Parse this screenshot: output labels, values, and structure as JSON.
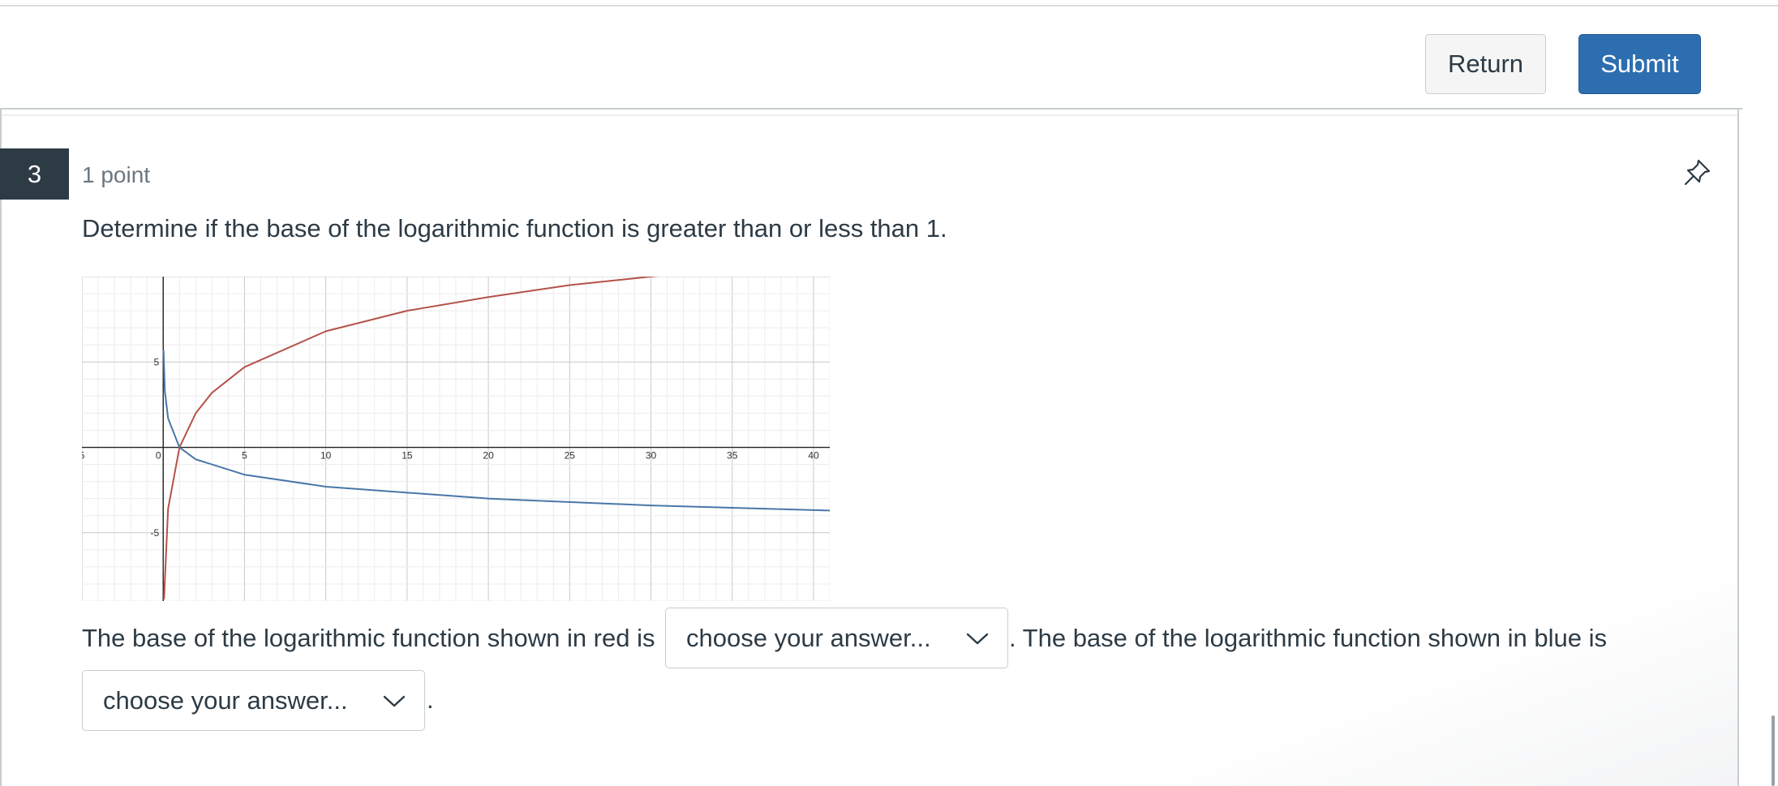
{
  "header": {
    "return_label": "Return",
    "submit_label": "Submit"
  },
  "question": {
    "number": "3",
    "points": "1 point",
    "prompt": "Determine if the base of the logarithmic function is greater than or less than 1.",
    "sentence_part1": "The base of the logarithmic function shown in red is",
    "sentence_part2": ". The base of the logarithmic function shown in blue is",
    "sentence_end": ".",
    "select1_value": "choose your answer...",
    "select2_value": "choose your answer..."
  },
  "icons": {
    "pin": "pin-icon",
    "chevron": "chevron-down-icon"
  },
  "colors": {
    "submit": "#2d6eb0",
    "red_curve": "#b5524a",
    "blue_curve": "#4a76a8",
    "question_number_bg": "#2d3b45"
  },
  "chart_data": {
    "type": "line",
    "x_ticks": [
      "5",
      "0",
      "5",
      "10",
      "15",
      "20",
      "25",
      "30",
      "35",
      "40"
    ],
    "y_ticks": [
      "5",
      "-5"
    ],
    "xlim": [
      -5,
      41
    ],
    "ylim": [
      -9,
      10
    ],
    "grid": true,
    "series": [
      {
        "color": "#b5524a",
        "x": [
          0.05,
          0.3,
          1,
          2,
          3,
          5,
          10,
          15,
          20,
          25,
          30,
          35,
          41
        ],
        "y": [
          -8.9,
          -3.6,
          0,
          2.0,
          3.2,
          4.7,
          6.8,
          8.0,
          8.8,
          9.5,
          10.0,
          10.5,
          11.0
        ]
      },
      {
        "color": "#4a76a8",
        "x": [
          0.02,
          0.1,
          0.3,
          1,
          2,
          5,
          10,
          20,
          30,
          41
        ],
        "y": [
          5.7,
          3.3,
          1.7,
          0,
          -0.7,
          -1.6,
          -2.3,
          -3.0,
          -3.4,
          -3.7
        ]
      }
    ]
  }
}
